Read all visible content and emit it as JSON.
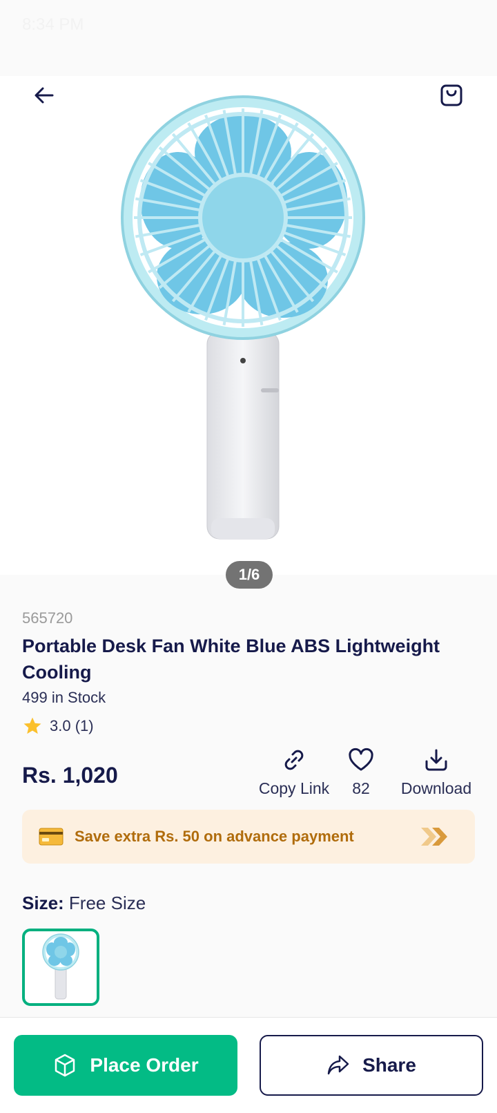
{
  "status_bar": {
    "time": "8:34 PM"
  },
  "gallery": {
    "page_indicator": "1/6",
    "image": "portable-fan-image"
  },
  "product": {
    "sku": "565720",
    "title": "Portable Desk Fan White Blue ABS Lightweight Cooling",
    "stock": "499 in Stock",
    "rating": "3.0 (1)",
    "rating_value": 3.0,
    "price": "Rs. 1,020"
  },
  "actions": {
    "copy_link": "Copy Link",
    "likes": "82",
    "download": "Download"
  },
  "banner": {
    "text": "Save extra Rs. 50 on advance payment"
  },
  "size": {
    "label": "Size:",
    "value": "Free Size"
  },
  "bottom": {
    "order": "Place Order",
    "share": "Share"
  },
  "colors": {
    "primary_text": "#161a4a",
    "accent_green": "#03bb85",
    "banner_bg": "#fdf0e0",
    "banner_text": "#b06c0c",
    "star": "#fbc02d"
  }
}
